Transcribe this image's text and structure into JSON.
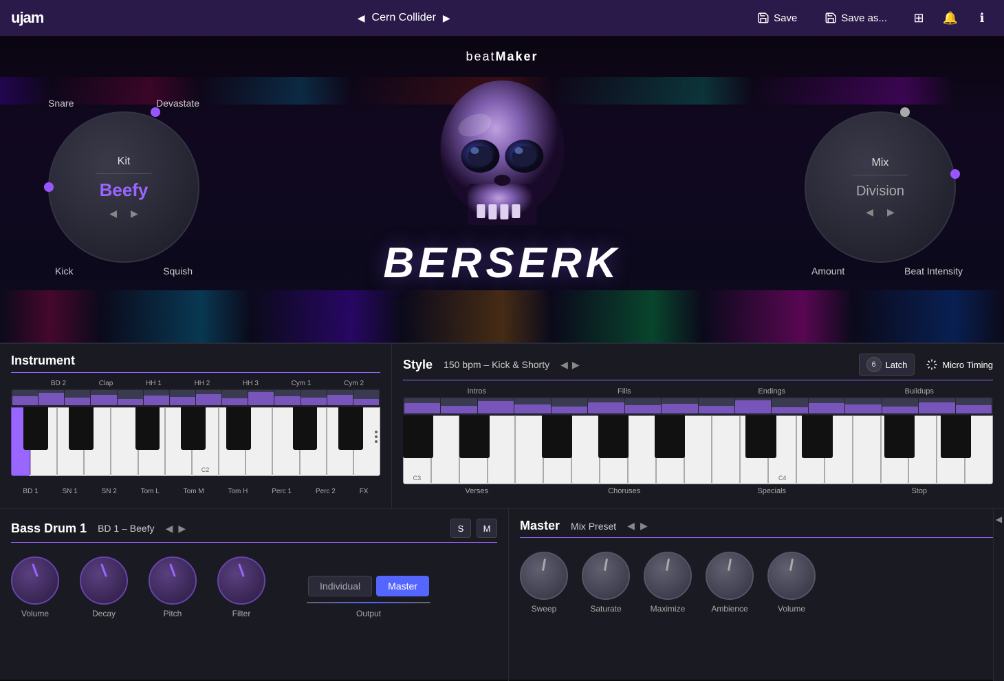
{
  "topbar": {
    "logo": "ujam",
    "preset_name": "Cern Collider",
    "save_label": "Save",
    "save_as_label": "Save as...",
    "nav_prev": "◀",
    "nav_next": "▶"
  },
  "main": {
    "beatmaker_label": "beat",
    "beatmaker_bold": "Maker",
    "product_name": "BERSERK",
    "kit_knob": {
      "label": "Kit",
      "value": "Beefy"
    },
    "mix_knob": {
      "label": "Mix",
      "sub_label": "Division"
    },
    "labels": {
      "snare": "Snare",
      "devastate": "Devastate",
      "kick": "Kick",
      "squish": "Squish",
      "amount": "Amount",
      "beat_intensity": "Beat Intensity"
    }
  },
  "instrument": {
    "title": "Instrument",
    "tracks": [
      "BD 2",
      "Clap",
      "HH 1",
      "HH 2",
      "HH 3",
      "Cym 1",
      "Cym 2"
    ],
    "bottom_labels": [
      "BD 1",
      "SN 1",
      "SN 2",
      "Tom L",
      "Tom M",
      "Tom H",
      "Perc 1",
      "Perc 2",
      "FX"
    ],
    "note_c2": "C2"
  },
  "style": {
    "title": "Style",
    "bpm_info": "150 bpm – Kick & Shorty",
    "latch_label": "Latch",
    "micro_timing_label": "Micro Timing",
    "categories_top": [
      "Intros",
      "Fills",
      "Endings",
      "Buildups"
    ],
    "categories_bottom": [
      "Verses",
      "Choruses",
      "Specials",
      "Stop"
    ],
    "note_c3": "C3",
    "note_c4": "C4"
  },
  "bass_drum": {
    "title": "Bass Drum 1",
    "preset": "BD 1 – Beefy",
    "knobs": [
      {
        "label": "Volume"
      },
      {
        "label": "Decay"
      },
      {
        "label": "Pitch"
      },
      {
        "label": "Filter"
      }
    ],
    "output_individual": "Individual",
    "output_master": "Master",
    "output_label": "Output",
    "s_btn": "S",
    "m_btn": "M"
  },
  "master": {
    "title": "Master",
    "mix_preset": "Mix Preset",
    "knobs": [
      {
        "label": "Sweep"
      },
      {
        "label": "Saturate"
      },
      {
        "label": "Maximize"
      },
      {
        "label": "Ambience"
      },
      {
        "label": "Volume"
      }
    ]
  }
}
